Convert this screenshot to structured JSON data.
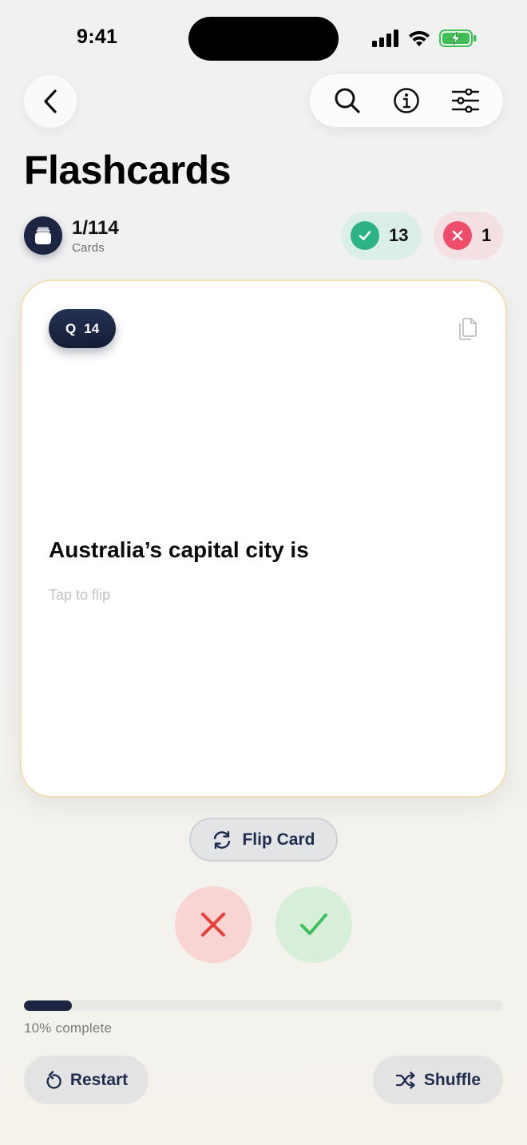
{
  "status_bar": {
    "time": "9:41"
  },
  "header": {
    "title": "Flashcards"
  },
  "progress_summary": {
    "current": "1/114",
    "label": "Cards"
  },
  "score": {
    "correct": "13",
    "wrong": "1"
  },
  "card": {
    "badge_prefix": "Q",
    "badge_number": "14",
    "question": "Australia’s capital city is",
    "hint": "Tap to flip"
  },
  "controls": {
    "flip_label": "Flip Card",
    "restart_label": "Restart",
    "shuffle_label": "Shuffle"
  },
  "progress": {
    "fraction": 0.1,
    "label": "10% complete"
  },
  "icons": [
    "back-icon",
    "search-icon",
    "info-icon",
    "settings-sliders-icon",
    "deck-icon",
    "check-icon",
    "close-icon",
    "copy-icon",
    "refresh-icon",
    "restart-icon",
    "shuffle-icon"
  ],
  "colors": {
    "accent": "#1c2642",
    "correct": "#2bb384",
    "wrong": "#ef4d6a",
    "card_border": "#f1dfb4"
  }
}
